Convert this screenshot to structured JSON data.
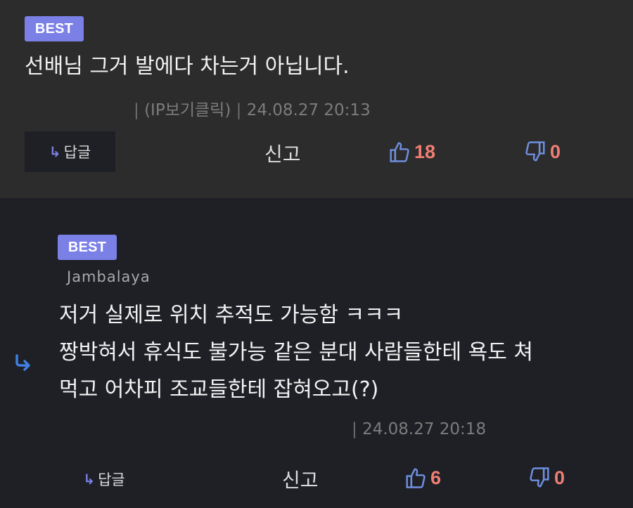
{
  "colors": {
    "badge_bg": "#7b80e6",
    "accent_blue": "#7b80e6",
    "count_red": "#ef7e74",
    "comment1_bg": "#2c2c2c",
    "comment2_bg": "#1e2026"
  },
  "comments": [
    {
      "badge": "BEST",
      "content_lines": [
        "선배님 그거 발에다 차는거 아닙니다."
      ],
      "ip_label": "(IP보기클릭)",
      "datetime": "24.08.27 20:13",
      "reply_arrow": "↳",
      "reply_label": "답글",
      "report_label": "신고",
      "upvotes": "18",
      "downvotes": "0",
      "icons": {
        "reply": "reply-arrow-icon",
        "up": "thumbs-up-icon",
        "down": "thumbs-down-icon"
      }
    },
    {
      "badge": "BEST",
      "author": "Jambalaya",
      "content_lines": [
        "저거 실제로 위치 추적도 가능함 ㅋㅋㅋ",
        "짱박혀서 휴식도 불가능 같은 분대 사람들한테 욕도 쳐",
        "먹고 어차피 조교들한테 잡혀오고(?)"
      ],
      "datetime": "24.08.27 20:18",
      "reply_arrow": "↳",
      "reply_label": "답글",
      "report_label": "신고",
      "upvotes": "6",
      "downvotes": "0",
      "icons": {
        "nested": "nested-reply-arrow-icon",
        "reply": "reply-arrow-icon",
        "up": "thumbs-up-icon",
        "down": "thumbs-down-icon"
      }
    }
  ]
}
